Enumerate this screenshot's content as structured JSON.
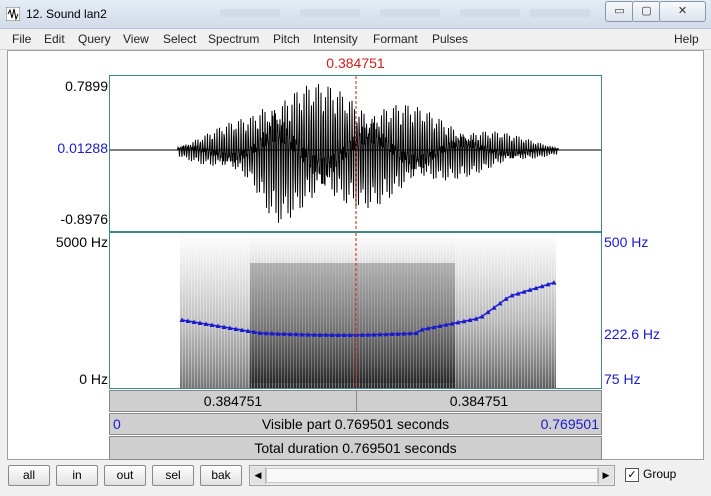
{
  "window": {
    "title": "12. Sound lan2",
    "min_glyph": "▭",
    "max_glyph": "▢",
    "close_glyph": "✕"
  },
  "menu": [
    "File",
    "Edit",
    "Query",
    "View",
    "Select",
    "Spectrum",
    "Pitch",
    "Intensity",
    "Formant",
    "Pulses",
    "Help"
  ],
  "cursor_time": "0.384751",
  "waveform": {
    "ymax": "0.7899",
    "ymid": "0.01288",
    "ymin": "-0.8976"
  },
  "spectrogram": {
    "fmax": "5000 Hz",
    "fmin": "0 Hz",
    "pitch_top": "500 Hz",
    "pitch_mid": "222.6 Hz",
    "pitch_bottom": "75 Hz"
  },
  "selection_bar": {
    "left": "0.384751",
    "right": "0.384751"
  },
  "visible_bar": {
    "start": "0",
    "text": "Visible part 0.769501 seconds",
    "end": "0.769501"
  },
  "total_bar": {
    "text": "Total duration 0.769501 seconds"
  },
  "buttons": {
    "all": "all",
    "in": "in",
    "out": "out",
    "sel": "sel",
    "bak": "bak"
  },
  "group": {
    "label": "Group",
    "checked": true,
    "check_glyph": "✓"
  },
  "colors": {
    "cursor": "#d41c1c",
    "pitch": "#1a1ad0",
    "axis_blue": "#1a1ad0"
  }
}
